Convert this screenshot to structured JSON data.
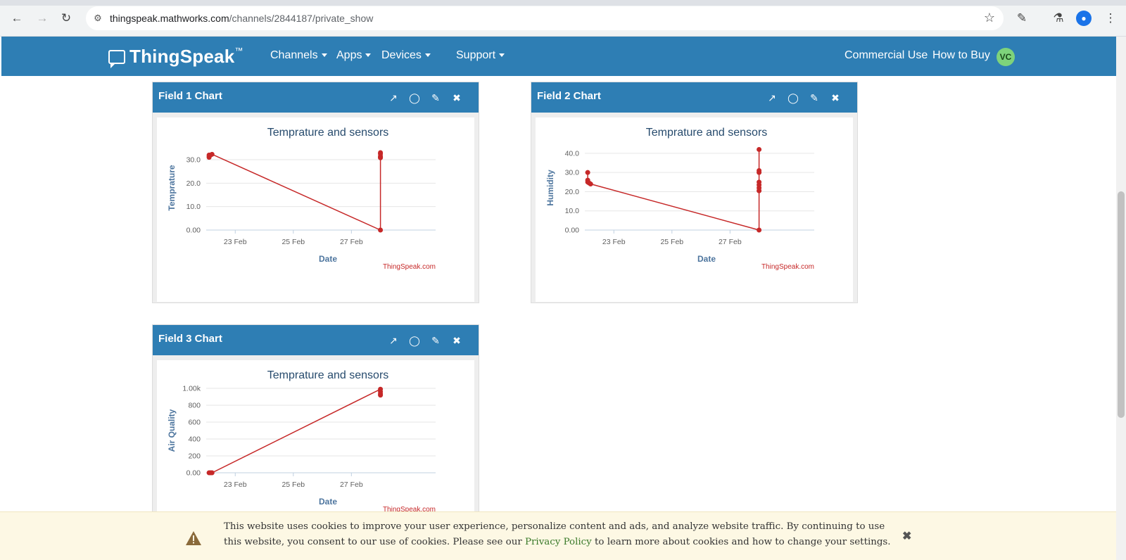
{
  "browser": {
    "url_host": "thingspeak.mathworks.com",
    "url_path": "/channels/2844187/private_show"
  },
  "site": {
    "logo": "ThingSpeak",
    "logo_tm": "™",
    "menus": [
      {
        "label": "Channels"
      },
      {
        "label": "Apps"
      },
      {
        "label": "Devices"
      },
      {
        "label": "Support"
      }
    ],
    "right_links": [
      "Commercial Use",
      "How to Buy"
    ],
    "avatar_initials": "VC",
    "brand_color": "#2e7eb4"
  },
  "chart_data": [
    {
      "panel_title": "Field 1 Chart",
      "type": "line",
      "title": "Temprature and sensors",
      "xlabel": "Date",
      "ylabel": "Temprature",
      "credit": "ThingSpeak.com",
      "x_ticks": [
        "23 Feb",
        "25 Feb",
        "27 Feb"
      ],
      "y_ticks": [
        "0.00",
        "10.0",
        "20.0",
        "30.0"
      ],
      "ylim": [
        0,
        36
      ],
      "xlim": [
        22.0,
        29.9
      ],
      "color": "#c62828",
      "points": [
        [
          22.1,
          31.0
        ],
        [
          22.1,
          32.0
        ],
        [
          22.1,
          31.5
        ],
        [
          22.15,
          32.0
        ],
        [
          22.2,
          32.3
        ],
        [
          28.0,
          0.0
        ],
        [
          28.0,
          30.8
        ],
        [
          28.0,
          31.5
        ],
        [
          28.0,
          32.5
        ],
        [
          28.0,
          33.0
        ],
        [
          28.0,
          31.0
        ]
      ]
    },
    {
      "panel_title": "Field 2 Chart",
      "type": "line",
      "title": "Temprature and sensors",
      "xlabel": "Date",
      "ylabel": "Humidity",
      "credit": "ThingSpeak.com",
      "x_ticks": [
        "23 Feb",
        "25 Feb",
        "27 Feb"
      ],
      "y_ticks": [
        "0.00",
        "10.0",
        "20.0",
        "30.0",
        "40.0"
      ],
      "ylim": [
        0,
        44
      ],
      "xlim": [
        22.0,
        29.9
      ],
      "color": "#c62828",
      "points": [
        [
          22.1,
          30.0
        ],
        [
          22.1,
          25.0
        ],
        [
          22.1,
          26.0
        ],
        [
          22.15,
          24.5
        ],
        [
          22.2,
          24.0
        ],
        [
          28.0,
          0.0
        ],
        [
          28.0,
          20.5
        ],
        [
          28.0,
          22.0
        ],
        [
          28.0,
          23.5
        ],
        [
          28.0,
          25.0
        ],
        [
          28.0,
          30.0
        ],
        [
          28.0,
          31.0
        ],
        [
          28.0,
          42.0
        ]
      ]
    },
    {
      "panel_title": "Field 3 Chart",
      "type": "line",
      "title": "Temprature and sensors",
      "xlabel": "Date",
      "ylabel": "Air Quality",
      "credit": "ThingSpeak.com",
      "x_ticks": [
        "23 Feb",
        "25 Feb",
        "27 Feb"
      ],
      "y_ticks": [
        "0.00",
        "200",
        "400",
        "600",
        "800",
        "1.00k"
      ],
      "ylim": [
        0,
        1000
      ],
      "xlim": [
        22.0,
        29.9
      ],
      "color": "#c62828",
      "points": [
        [
          22.1,
          0
        ],
        [
          22.15,
          0
        ],
        [
          22.2,
          0
        ],
        [
          28.0,
          990
        ],
        [
          28.0,
          960
        ],
        [
          28.0,
          935
        ],
        [
          28.0,
          920
        ]
      ]
    }
  ],
  "cookie": {
    "text_before": "This website uses cookies to improve your user experience, personalize content and ads, and analyze website traffic. By continuing to use this website, you consent to our use of cookies. Please see our ",
    "link": "Privacy Policy",
    "text_after": " to learn more about cookies and how to change your settings."
  }
}
